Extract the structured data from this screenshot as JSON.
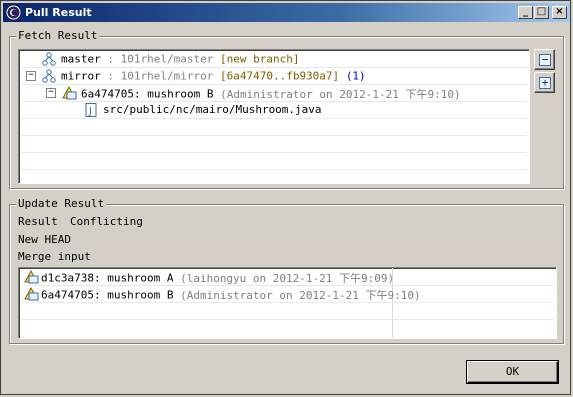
{
  "window": {
    "title": "Pull Result",
    "minimize_label": "_",
    "maximize_label": "□",
    "close_label": "×"
  },
  "fetch": {
    "group_label": "Fetch Result",
    "rows": [
      {
        "ref": "master",
        "sep": " : ",
        "remote": "101rhel/master",
        "status": "[new branch]"
      },
      {
        "ref": "mirror",
        "sep": " : ",
        "remote": "101rhel/mirror",
        "status": "[6a47470..fb930a7]",
        "count": "(1)"
      }
    ],
    "commit": {
      "id_msg": "6a474705: mushroom B",
      "meta": "(Administrator on 2012-1-21 下午9:10)"
    },
    "file": "src/public/nc/mairo/Mushroom.java",
    "collapse_label": "−",
    "expand_label": "+"
  },
  "update": {
    "group_label": "Update Result",
    "result_label": "Result",
    "result_value": "Conflicting",
    "new_head_label": "New HEAD",
    "merge_input_label": "Merge input",
    "merge_rows": [
      {
        "id_msg": "d1c3a738: mushroom A",
        "meta": "(laihongyu on 2012-1-21 下午9:09)"
      },
      {
        "id_msg": "6a474705: mushroom B",
        "meta": "(Administrator on 2012-1-21 下午9:10)"
      }
    ]
  },
  "buttons": {
    "ok": "OK"
  },
  "colors": {
    "title_start": "#0a246a",
    "title_end": "#a6caf0",
    "dialog_bg": "#d4d0c8"
  }
}
